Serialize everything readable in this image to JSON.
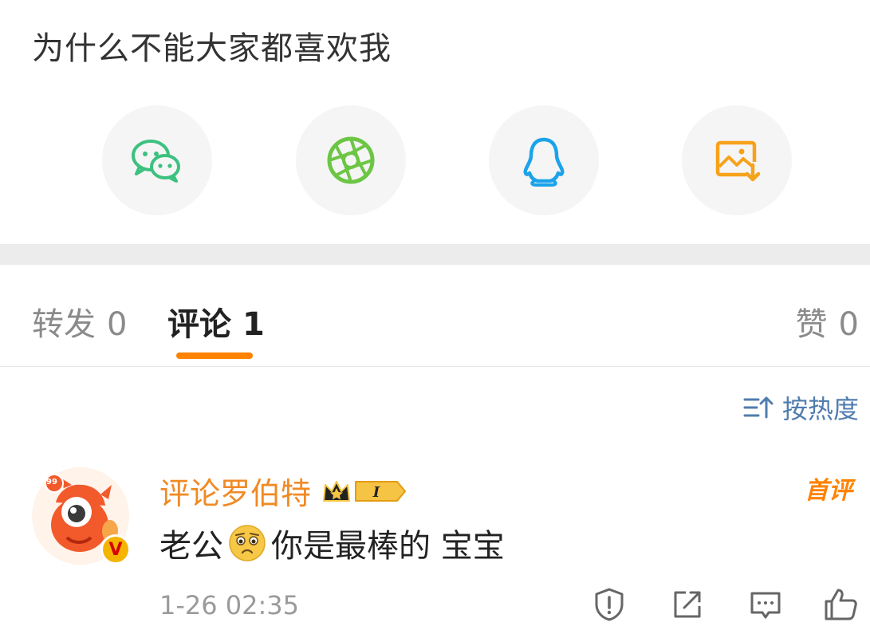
{
  "post": {
    "text": "为什么不能大家都喜欢我"
  },
  "share": {
    "items": [
      {
        "name": "wechat",
        "icon": "wechat-icon",
        "color": "#3cc17f"
      },
      {
        "name": "moments",
        "icon": "moments-aperture-icon",
        "color": "#6cc644"
      },
      {
        "name": "qq",
        "icon": "qq-penguin-icon",
        "color": "#1ba3ea"
      },
      {
        "name": "save-image",
        "icon": "save-image-icon",
        "color": "#f7a21b"
      }
    ]
  },
  "tabs": {
    "repost": {
      "label": "转发",
      "count": "0"
    },
    "comment": {
      "label": "评论",
      "count": "1"
    },
    "like": {
      "label": "赞",
      "count": "0"
    },
    "active": "comment",
    "accent": "#ff8200"
  },
  "sort": {
    "label": "按热度",
    "icon": "sort-icon"
  },
  "comments": [
    {
      "username": "评论罗伯特",
      "badge_level": "I",
      "first_label": "首评",
      "text_before": "老公",
      "emoji": "crying-face-emoji",
      "text_after": "你是最棒的 宝宝",
      "avatar_badge_count": "99",
      "verified_mark": "V",
      "time": "1-26 02:35",
      "actions": [
        "report-icon",
        "share-icon",
        "reply-icon",
        "like-icon"
      ]
    }
  ]
}
